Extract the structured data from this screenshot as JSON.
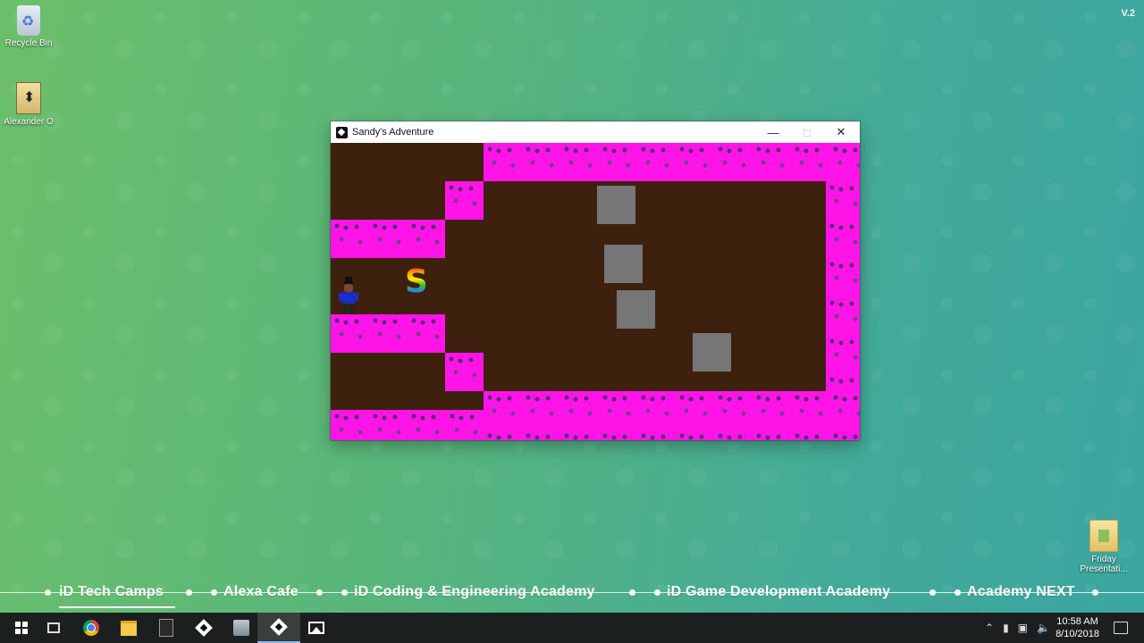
{
  "desktop": {
    "version_label": "V.2",
    "icons": [
      {
        "label": "Recycle Bin",
        "icon": "recycle-bin-icon"
      },
      {
        "label": "Alexander O",
        "icon": "document-icon"
      },
      {
        "label": "Friday Presentati...",
        "icon": "folder-icon"
      }
    ]
  },
  "window": {
    "title": "Sandy's Adventure",
    "minimize_glyph": "—",
    "maximize_glyph": "□",
    "close_glyph": "✕"
  },
  "game": {
    "floor_color": "#3e200f",
    "wall_color": "#ff14e8",
    "block_color": "#767676",
    "collectible_glyph": "S",
    "player_sprite": "player-character",
    "block_count": 4
  },
  "nav_bar": {
    "links": [
      "iD Tech Camps",
      "Alexa Cafe",
      "iD Coding & Engineering Academy",
      "iD Game Development Academy",
      "Academy NEXT"
    ],
    "active": "iD Tech Camps"
  },
  "taskbar": {
    "pinned": [
      "start-icon",
      "task-view-icon",
      "chrome-icon",
      "file-explorer-icon",
      "epic-games-icon",
      "game-engine-icon",
      "archive-app-icon",
      "game-engine-icon",
      "photos-icon"
    ],
    "active_app": "game-engine-icon",
    "time": "10:58 AM",
    "date": "8/10/2018",
    "tray_icons": [
      "chevron-up-icon",
      "battery-icon",
      "network-icon",
      "volume-icon"
    ]
  }
}
